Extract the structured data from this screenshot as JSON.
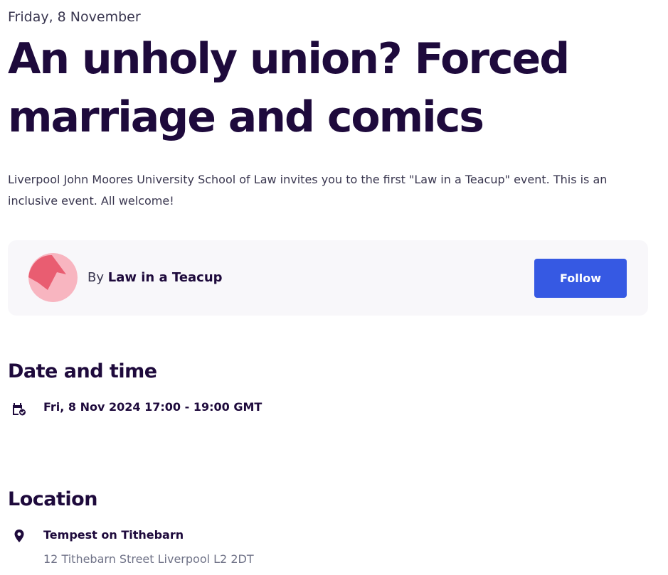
{
  "event": {
    "date_label": "Friday, 8 November",
    "title": "An unholy union? Forced marriage and comics",
    "summary": "Liverpool John Moores University School of Law invites you to the first \"Law in a Teacup\" event. This is an inclusive event. All welcome!"
  },
  "organizer": {
    "by_prefix": "By",
    "name": "Law in a Teacup",
    "avatar_icon": "organizer-avatar-logo",
    "follow_label": "Follow"
  },
  "date_and_time": {
    "heading": "Date and time",
    "icon": "calendar-check-icon",
    "value": "Fri, 8 Nov 2024 17:00 - 19:00 GMT"
  },
  "location": {
    "heading": "Location",
    "icon": "map-pin-icon",
    "venue": "Tempest on Tithebarn",
    "address": "12 Tithebarn Street Liverpool L2 2DT"
  },
  "colors": {
    "title_text": "#1e0a3c",
    "body_text": "#39364f",
    "muted_text": "#6f7287",
    "follow_button": "#3659e3",
    "card_background": "#f8f7fa",
    "avatar_light": "#f8b5c0",
    "avatar_dark": "#e95d71"
  }
}
